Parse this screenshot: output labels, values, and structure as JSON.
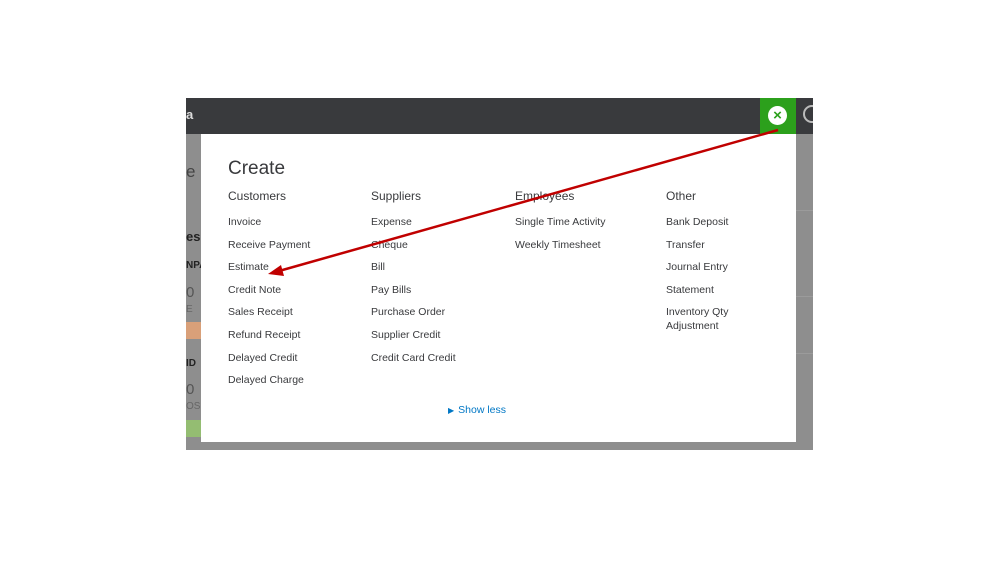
{
  "app": {
    "topbar_fragment": "a",
    "left_fragments": [
      "e",
      "es",
      "NPA",
      "0",
      "E",
      "ID",
      "0",
      "OS"
    ]
  },
  "panel": {
    "title": "Create",
    "columns": [
      {
        "heading": "Customers",
        "items": [
          "Invoice",
          "Receive Payment",
          "Estimate",
          "Credit Note",
          "Sales Receipt",
          "Refund Receipt",
          "Delayed Credit",
          "Delayed Charge"
        ]
      },
      {
        "heading": "Suppliers",
        "items": [
          "Expense",
          "Cheque",
          "Bill",
          "Pay Bills",
          "Purchase Order",
          "Supplier Credit",
          "Credit Card Credit"
        ]
      },
      {
        "heading": "Employees",
        "items": [
          "Single Time Activity",
          "Weekly Timesheet"
        ]
      },
      {
        "heading": "Other",
        "items": [
          "Bank Deposit",
          "Transfer",
          "Journal Entry",
          "Statement",
          "Inventory Qty Adjustment"
        ]
      }
    ],
    "show_less": "Show less"
  },
  "close_icon": "close-icon",
  "colors": {
    "accent_green": "#2ca01c",
    "link_blue": "#0077c5",
    "arrow_red": "#c00000",
    "topbar": "#393a3d"
  }
}
